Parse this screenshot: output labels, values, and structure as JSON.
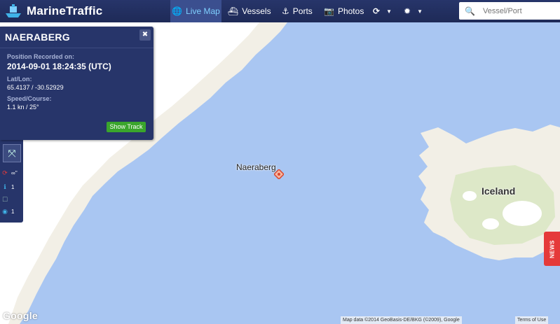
{
  "nav": {
    "brand": "MarineTraffic",
    "items": [
      {
        "label": "Live Map",
        "icon": "globe-icon"
      },
      {
        "label": "Vessels",
        "icon": "ship-icon"
      },
      {
        "label": "Ports",
        "icon": "anchor-icon"
      },
      {
        "label": "Photos",
        "icon": "camera-icon"
      }
    ],
    "search_placeholder": "Vessel/Port"
  },
  "info_panel": {
    "vessel_name": "NAERABERG",
    "close_symbol": "✖",
    "position_label": "Position Recorded on:",
    "position_time": "2014-09-01 18:24:35 (UTC)",
    "latlon_label": "Lat/Lon:",
    "latlon_value": "65.4137 / -30.52929",
    "speed_label": "Speed/Course:",
    "speed_value": "1.1 kn / 25°",
    "show_track": "Show Track"
  },
  "side_tools": {
    "rows": [
      {
        "icon": "refresh-icon",
        "text": "∞''"
      },
      {
        "icon": "info-icon",
        "text": "1"
      },
      {
        "icon": "checkbox-icon",
        "text": ""
      },
      {
        "icon": "eye-icon",
        "text": "1"
      }
    ]
  },
  "map": {
    "vessel_label": "Naeraberg",
    "country_label": "Iceland",
    "google": "Google",
    "attribution": "Map data ©2014 GeoBasis-DE/BKG (©2009), Google",
    "terms": "Terms of Use",
    "ocean_color": "#a9c6f2",
    "land_color": "#f2efe6",
    "ice_color": "#ffffff"
  },
  "news": "NEWS"
}
